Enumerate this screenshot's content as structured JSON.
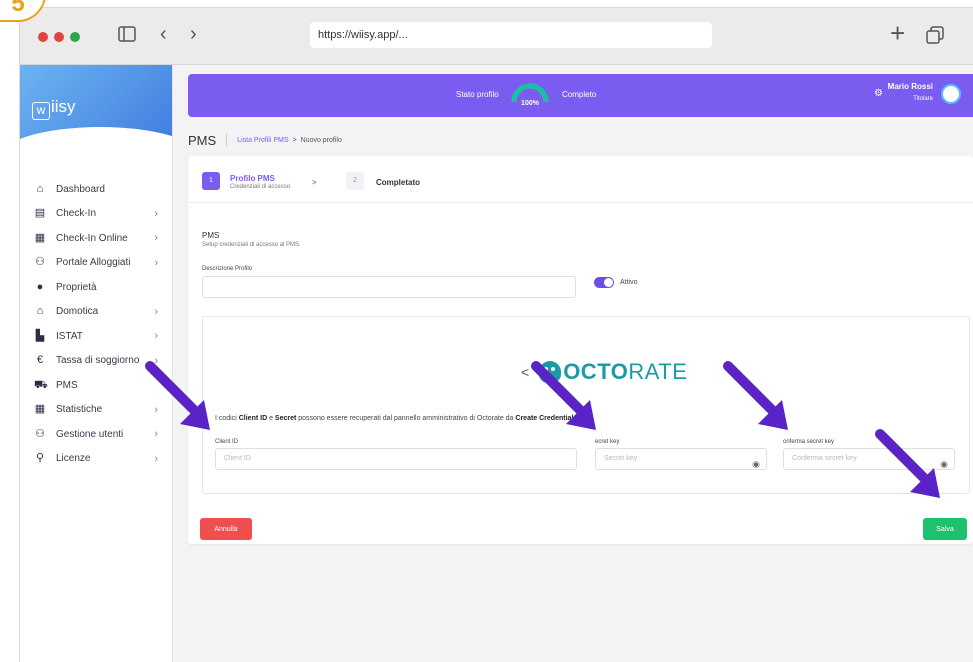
{
  "tutorial_step": "5",
  "browser": {
    "url": "https://wiisy.app/..."
  },
  "app": {
    "logo_text": "iisy",
    "logo_letter": "w"
  },
  "sidebar": {
    "items": [
      {
        "label": "Dashboard",
        "icon": "home-icon",
        "has_children": false
      },
      {
        "label": "Check-In",
        "icon": "id-card-icon",
        "has_children": true
      },
      {
        "label": "Check-In Online",
        "icon": "calendar-check-icon",
        "has_children": true
      },
      {
        "label": "Portale Alloggiati",
        "icon": "users-group-icon",
        "has_children": true
      },
      {
        "label": "Proprietà",
        "icon": "map-pin-icon",
        "has_children": false
      },
      {
        "label": "Domotica",
        "icon": "smart-home-icon",
        "has_children": true
      },
      {
        "label": "ISTAT",
        "icon": "bar-chart-icon",
        "has_children": true
      },
      {
        "label": "Tassa di soggiorno",
        "icon": "euro-icon",
        "has_children": true
      },
      {
        "label": "PMS",
        "icon": "car-icon",
        "has_children": false
      },
      {
        "label": "Statistiche",
        "icon": "table-icon",
        "has_children": true
      },
      {
        "label": "Gestione utenti",
        "icon": "users-icon",
        "has_children": true
      },
      {
        "label": "Licenze",
        "icon": "user-key-icon",
        "has_children": true
      }
    ]
  },
  "topbar": {
    "profile_status_label": "Stato profilo",
    "profile_percent": "100%",
    "profile_percent_value": 1.0,
    "profile_complete_label": "Completo",
    "user_name": "Mario Rossi",
    "user_role": "Titolare"
  },
  "page": {
    "title": "PMS",
    "breadcrumb_link": "Lista Profili PMS",
    "breadcrumb_sep": ">",
    "breadcrumb_current": "Nuovo profilo"
  },
  "stepper": {
    "step1_num": "1",
    "step1_title": "Profilo PMS",
    "step1_sub": "Credenziali di accesso",
    "arrow": ">",
    "step2_num": "2",
    "step2_title": "Completato"
  },
  "form": {
    "section_title": "PMS",
    "section_sub": "Setup credenziali di accesso al PMS.",
    "descrizione_label": "Descrizione Profilo",
    "descrizione_value": "",
    "toggle_label": "Attivo",
    "toggle_on": true,
    "provider_prev": "<",
    "provider_name_bold": "OCTO",
    "provider_name_light": "RATE",
    "note_pre": "I codici ",
    "note_b1": "Client ID",
    "note_mid1": " e ",
    "note_b2": "Secret",
    "note_mid2": " possono essere recuperati dal pannello amministrativo di Octorate da ",
    "note_b3": "Create Credentials",
    "client_id_label": "Client ID",
    "client_id_placeholder": "Client ID",
    "secret_label": "ecret key",
    "secret_placeholder": "Secret key",
    "confirm_label": "onferma secret key",
    "confirm_placeholder": "Conferma secret key"
  },
  "actions": {
    "cancel_label": "Annulla",
    "save_label": "Salva"
  },
  "colors": {
    "accent": "#7b5cf0",
    "cancel": "#ef4f4f",
    "save": "#1cc36e",
    "arrow": "#5a23c8",
    "badge": "#e8a21a"
  }
}
